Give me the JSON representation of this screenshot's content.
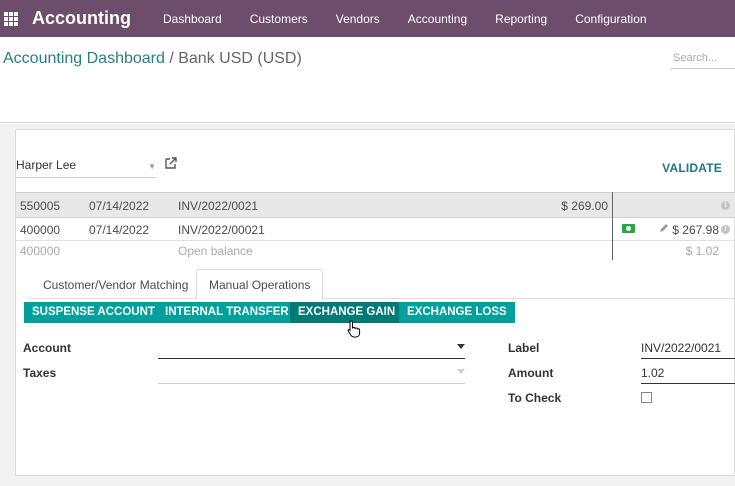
{
  "app": {
    "brand": "Accounting",
    "apps_icon": "apps-grid-icon"
  },
  "menu": [
    "Dashboard",
    "Customers",
    "Vendors",
    "Accounting",
    "Reporting",
    "Configuration"
  ],
  "breadcrumb": {
    "parent": "Accounting Dashboard",
    "separator": " / ",
    "current": "Bank USD (USD)"
  },
  "search": {
    "placeholder": "Search..."
  },
  "reconcile": {
    "partner": "Harper Lee",
    "validate_label": "VALIDATE",
    "lines": [
      {
        "account": "550005",
        "date": "07/14/2022",
        "label": "INV/2022/0021",
        "debit": "$ 269.00",
        "credit": ""
      },
      {
        "account": "400000",
        "date": "07/14/2022",
        "label": "INV/2022/00021",
        "debit": "",
        "credit": "$ 267.98"
      },
      {
        "account": "400000",
        "date": "",
        "label": "Open balance",
        "debit": "",
        "credit": "$ 1.02"
      }
    ],
    "tabs": [
      "Customer/Vendor Matching",
      "Manual Operations"
    ],
    "active_tab": "Manual Operations",
    "operation_buttons": [
      "SUSPENSE ACCOUNT",
      "INTERNAL TRANSFER",
      "EXCHANGE GAIN",
      "EXCHANGE LOSS"
    ],
    "hovered_button": "EXCHANGE GAIN",
    "form": {
      "account_label": "Account",
      "account_value": "",
      "taxes_label": "Taxes",
      "taxes_value": "",
      "label_label": "Label",
      "label_value": "INV/2022/0021",
      "amount_label": "Amount",
      "amount_value": "1.02",
      "to_check_label": "To Check",
      "to_check_value": false
    }
  },
  "colors": {
    "navbar": "#6c4d6a",
    "accent": "#00a09d",
    "link": "#2a7f80"
  }
}
